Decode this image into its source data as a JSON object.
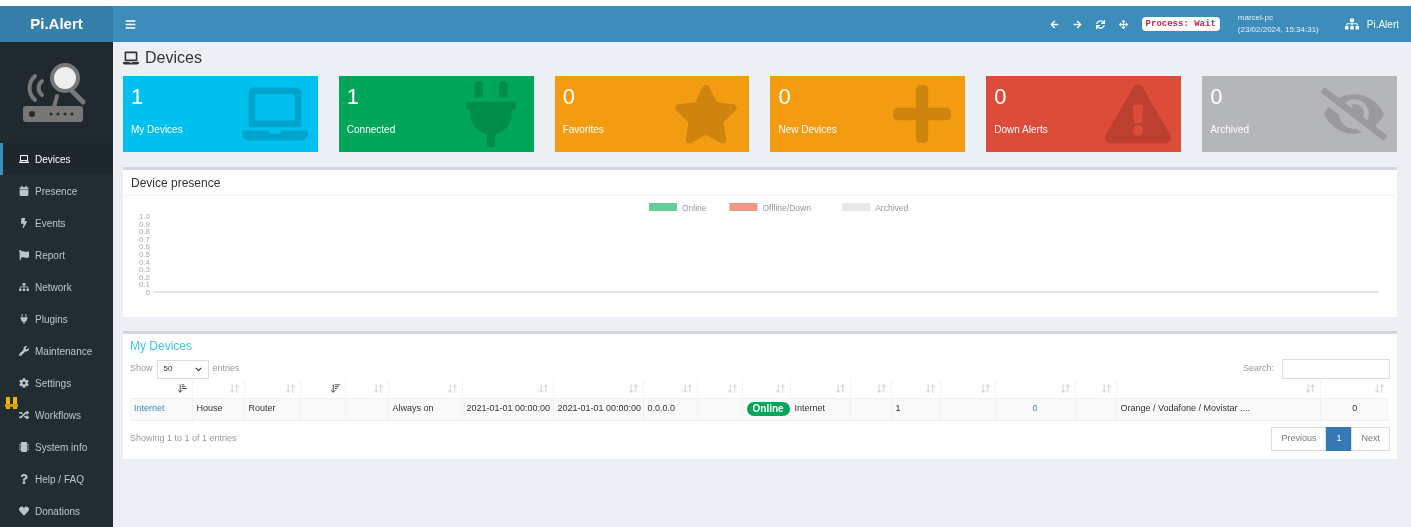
{
  "brand": "Pi.Alert",
  "topbar": {
    "process_badge": "Process: Wait",
    "host": "marcel-pc",
    "timestamp": "(23/02/2024, 15:34:31)",
    "app_name": "Pi.Alert"
  },
  "sidebar": {
    "items": [
      {
        "label": "Devices",
        "selected": true
      },
      {
        "label": "Presence",
        "selected": false
      },
      {
        "label": "Events",
        "selected": false
      },
      {
        "label": "Report",
        "selected": false
      },
      {
        "label": "Network",
        "selected": false
      },
      {
        "label": "Plugins",
        "selected": false
      },
      {
        "label": "Maintenance",
        "selected": false
      },
      {
        "label": "Settings",
        "selected": false
      },
      {
        "label": "Workflows",
        "selected": false,
        "flagged": true
      },
      {
        "label": "System info",
        "selected": false
      },
      {
        "label": "Help / FAQ",
        "selected": false
      },
      {
        "label": "Donations",
        "selected": false
      }
    ]
  },
  "page_title": "Devices",
  "stat_cards": [
    {
      "value": "1",
      "label": "My Devices",
      "color": "#00c0ef"
    },
    {
      "value": "1",
      "label": "Connected",
      "color": "#00a65a"
    },
    {
      "value": "0",
      "label": "Favorites",
      "color": "#f39c12"
    },
    {
      "value": "0",
      "label": "New Devices",
      "color": "#f39c12"
    },
    {
      "value": "0",
      "label": "Down Alerts",
      "color": "#dd4b39"
    },
    {
      "value": "0",
      "label": "Archived",
      "color": "#b5b6b9"
    }
  ],
  "presence": {
    "title": "Device presence",
    "chart_data": {
      "type": "bar",
      "series": [
        {
          "name": "Online",
          "color": "#66cc99"
        },
        {
          "name": "Offline/Down",
          "color": "#ee9988"
        },
        {
          "name": "Archived",
          "color": "#e8e8e8"
        }
      ],
      "ylim": [
        0,
        1
      ],
      "yticks": [
        0,
        0.1,
        0.2,
        0.3,
        0.4,
        0.5,
        0.6,
        0.7,
        0.8,
        0.9,
        {
          "value": 1,
          "label": "1.0"
        }
      ]
    }
  },
  "devices_table": {
    "title": "My Devices",
    "show_label": "Show",
    "page_size": "50",
    "entries_label": "entries",
    "search_label": "Search:",
    "columns": [
      {
        "kind": "asc"
      },
      {
        "kind": "none"
      },
      {
        "kind": "none"
      },
      {
        "kind": "desc"
      },
      {
        "kind": "none"
      },
      {
        "kind": "none"
      },
      {
        "kind": "none"
      },
      {
        "kind": "none"
      },
      {
        "kind": "none"
      },
      {
        "kind": "none"
      },
      {
        "kind": "none"
      },
      {
        "kind": "none"
      },
      {
        "kind": "none"
      },
      {
        "kind": "none"
      },
      {
        "kind": "none"
      },
      {
        "kind": "none"
      },
      {
        "kind": "none"
      },
      {
        "kind": "none"
      },
      {
        "kind": "none"
      }
    ],
    "rows": [
      {
        "cells": [
          {
            "kind": "link",
            "text": "Internet"
          },
          {
            "kind": "text",
            "text": "House"
          },
          {
            "kind": "text",
            "text": "Router"
          },
          {
            "kind": "empty"
          },
          {
            "kind": "empty"
          },
          {
            "kind": "text",
            "text": "Always on"
          },
          {
            "kind": "text",
            "text": "2021-01-01 00:00:00"
          },
          {
            "kind": "text",
            "text": "2021-01-01 00:00:00"
          },
          {
            "kind": "text",
            "text": "0.0.0.0"
          },
          {
            "kind": "empty"
          },
          {
            "kind": "badge",
            "text": "Online"
          },
          {
            "kind": "text",
            "text": "Internet"
          },
          {
            "kind": "empty"
          },
          {
            "kind": "text",
            "text": "1"
          },
          {
            "kind": "empty"
          },
          {
            "kind": "center-link",
            "text": "0"
          },
          {
            "kind": "empty"
          },
          {
            "kind": "text",
            "text": "Orange / Vodafone / Movistar ...."
          },
          {
            "kind": "center",
            "text": "0"
          }
        ]
      }
    ],
    "info": "Showing 1 to 1 of 1 entries",
    "pagination": [
      {
        "label": "Previous",
        "selected": false
      },
      {
        "label": "1",
        "selected": true
      },
      {
        "label": "Next",
        "selected": false
      }
    ]
  }
}
